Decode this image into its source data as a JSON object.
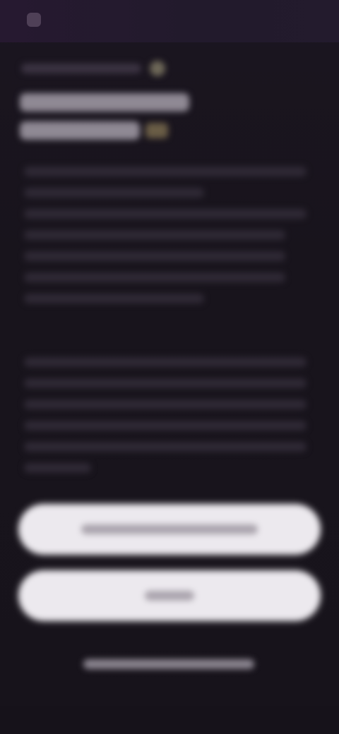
{
  "screen": {
    "background": "#18141d",
    "accent_dark": "#261930",
    "button_color": "#ece9ee",
    "note": ""
  },
  "header": {
    "status_left": "",
    "status_right": "",
    "logo_icon": "app-logo-icon"
  },
  "content": {
    "breadcrumb": "",
    "breadcrumb_icon": "info-icon",
    "title_line_1": "",
    "title_line_2": "",
    "paragraph_1": "",
    "paragraph_2": ""
  },
  "actions": {
    "primary_label": "",
    "secondary_label": "",
    "footer_link": ""
  }
}
